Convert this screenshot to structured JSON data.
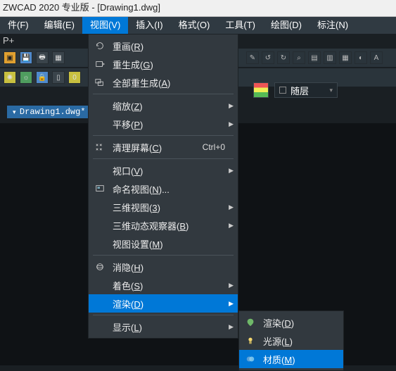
{
  "title": "ZWCAD 2020 专业版 - [Drawing1.dwg]",
  "ptag": "P+",
  "menubar": {
    "items": [
      {
        "label": "件(F)"
      },
      {
        "label": "编辑(E)"
      },
      {
        "label": "视图(V)",
        "active": true
      },
      {
        "label": "插入(I)"
      },
      {
        "label": "格式(O)"
      },
      {
        "label": "工具(T)"
      },
      {
        "label": "绘图(D)"
      },
      {
        "label": "标注(N)"
      }
    ]
  },
  "layer_select": {
    "value": "随层"
  },
  "filetab": {
    "label": "Drawing1.dwg*"
  },
  "view_menu": {
    "items": [
      {
        "icon": "redraw-icon",
        "label": "重画",
        "mn": "R"
      },
      {
        "icon": "regen-icon",
        "label": "重生成",
        "mn": "G"
      },
      {
        "icon": "regenall-icon",
        "label": "全部重生成",
        "mn": "A"
      },
      {
        "sep": true
      },
      {
        "icon": "",
        "label": "缩放",
        "mn": "Z",
        "sub": true
      },
      {
        "icon": "",
        "label": "平移",
        "mn": "P",
        "sub": true
      },
      {
        "sep": true
      },
      {
        "icon": "clean-icon",
        "label": "清理屏幕",
        "mn": "C",
        "accel": "Ctrl+0"
      },
      {
        "sep": true
      },
      {
        "icon": "",
        "label": "视口",
        "mn": "V",
        "sub": true
      },
      {
        "icon": "namedview-icon",
        "label": "命名视图",
        "mn": "N",
        "ellipsis": true
      },
      {
        "icon": "",
        "label": "三维视图",
        "mn": "3",
        "sub": true
      },
      {
        "icon": "",
        "label": "三维动态观察器",
        "mn": "B",
        "sub": true
      },
      {
        "icon": "",
        "label": "视图设置",
        "mn": "M"
      },
      {
        "sep": true
      },
      {
        "icon": "hide-icon",
        "label": "消隐",
        "mn": "H"
      },
      {
        "icon": "",
        "label": "着色",
        "mn": "S",
        "sub": true
      },
      {
        "icon": "",
        "label": "渲染",
        "mn": "D",
        "sub": true,
        "hl": true
      },
      {
        "sep": true
      },
      {
        "icon": "",
        "label": "显示",
        "mn": "L",
        "sub": true
      }
    ]
  },
  "render_submenu": {
    "items": [
      {
        "icon": "render-icon",
        "label": "渲染",
        "mn": "D"
      },
      {
        "icon": "light-icon",
        "label": "光源",
        "mn": "L"
      },
      {
        "icon": "material-icon",
        "label": "材质",
        "mn": "M",
        "hl": true
      }
    ]
  }
}
